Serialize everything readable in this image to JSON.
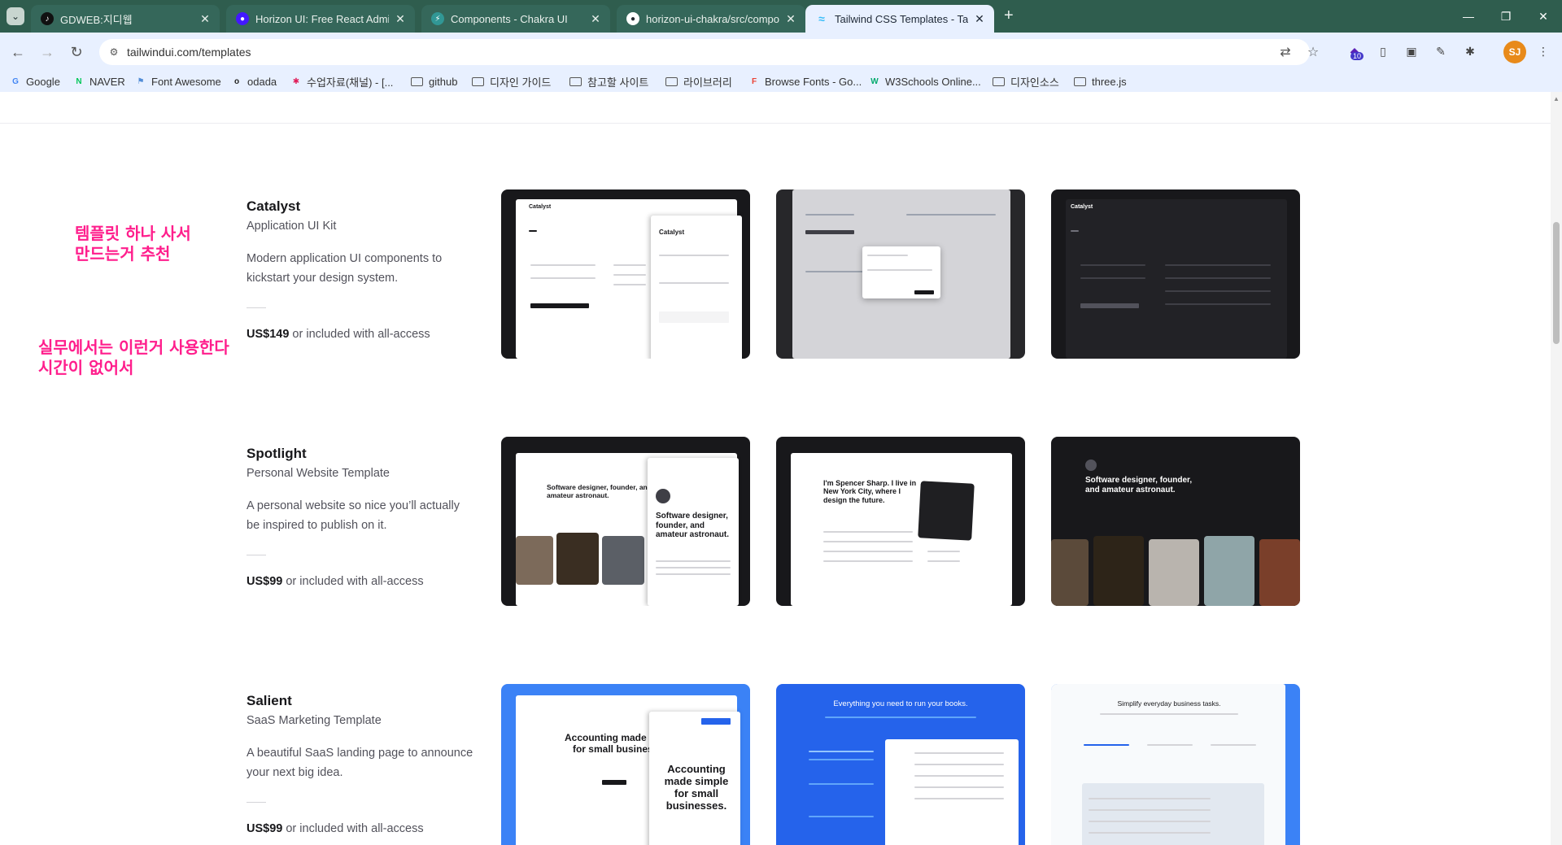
{
  "browser": {
    "tabs": [
      {
        "title": "GDWEB:지디웹",
        "fav_color": "#111111",
        "fav_glyph": "♪"
      },
      {
        "title": "Horizon UI: Free React Admin",
        "fav_color": "#4318ff",
        "fav_glyph": "◉"
      },
      {
        "title": "Components - Chakra UI",
        "fav_color": "#319795",
        "fav_glyph": "⚡"
      },
      {
        "title": "horizon-ui-chakra/src/compon",
        "fav_color": "#24292f",
        "fav_glyph": "●"
      },
      {
        "title": "Tailwind CSS Templates - Tailw",
        "fav_color": "#38bdf8",
        "fav_glyph": "≈"
      }
    ],
    "url": "tailwindui.com/templates",
    "avatar_initials": "SJ",
    "extension_badge": "10",
    "bookmarks": [
      {
        "label": "Google",
        "kind": "site",
        "icon_color": "#4285f4",
        "glyph": "G"
      },
      {
        "label": "NAVER",
        "kind": "site",
        "icon_color": "#03c75a",
        "glyph": "N"
      },
      {
        "label": "Font Awesome",
        "kind": "site",
        "icon_color": "#528dd7",
        "glyph": "⚑"
      },
      {
        "label": "odada",
        "kind": "site",
        "icon_color": "#222222",
        "glyph": "o"
      },
      {
        "label": "수업자료(채널) - [...",
        "kind": "site",
        "icon_color": "#e01e5a",
        "glyph": "✱"
      },
      {
        "label": "github",
        "kind": "folder"
      },
      {
        "label": "디자인 가이드",
        "kind": "folder"
      },
      {
        "label": "참고할 사이트",
        "kind": "folder"
      },
      {
        "label": "라이브러리",
        "kind": "folder"
      },
      {
        "label": "Browse Fonts - Go...",
        "kind": "site",
        "icon_color": "#ea4335",
        "glyph": "F"
      },
      {
        "label": "W3Schools Online...",
        "kind": "site",
        "icon_color": "#04aa6d",
        "glyph": "W"
      },
      {
        "label": "디자인소스",
        "kind": "folder"
      },
      {
        "label": "three.js",
        "kind": "folder"
      }
    ]
  },
  "notes": {
    "note1": [
      "템플릿 하나 사서",
      "만드는거 추천"
    ],
    "note2": [
      "실무에서는 이런거 사용한다",
      "시간이 없어서"
    ],
    "color": "#ff1e8c"
  },
  "products": [
    {
      "name": "Catalyst",
      "subtitle": "Application UI Kit",
      "description": "Modern application UI components to kickstart your design system.",
      "price": "US$149",
      "price_suffix": " or included with all-access",
      "thumb_texts": [
        "Catalyst",
        "Catalyst",
        "Catalyst"
      ]
    },
    {
      "name": "Spotlight",
      "subtitle": "Personal Website Template",
      "description": "A personal website so nice you’ll actually be inspired to publish on it.",
      "price": "US$99",
      "price_suffix": " or included with all-access",
      "thumb_texts": [
        "Software designer, founder, and amateur astronaut.",
        "I'm Spencer Sharp. I live in New York City, where I design the future.",
        "Software designer, founder, and amateur astronaut."
      ]
    },
    {
      "name": "Salient",
      "subtitle": "SaaS Marketing Template",
      "description": "A beautiful SaaS landing page to announce your next big idea.",
      "price": "US$99",
      "price_suffix": " or included with all-access",
      "thumb_texts": [
        "Accounting made simple for small businesses.",
        "Everything you need to run your books.",
        "Simplify everyday business tasks."
      ]
    }
  ]
}
